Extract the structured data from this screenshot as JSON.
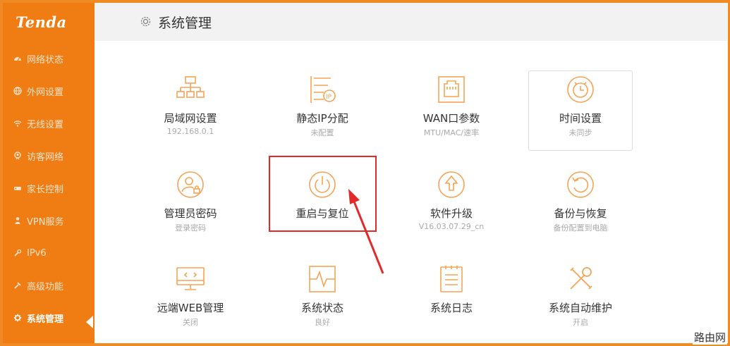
{
  "brand": {
    "logo": "Tenda",
    "accent": "#f07d14"
  },
  "sidebar": {
    "items": [
      {
        "label": "网络状态",
        "icon": "gauge-icon"
      },
      {
        "label": "外网设置",
        "icon": "globe-icon"
      },
      {
        "label": "无线设置",
        "icon": "wifi-icon"
      },
      {
        "label": "访客网络",
        "icon": "guest-icon"
      },
      {
        "label": "家长控制",
        "icon": "parental-icon"
      },
      {
        "label": "VPN服务",
        "icon": "vpn-icon"
      },
      {
        "label": "IPv6",
        "icon": "wrench-icon"
      },
      {
        "label": "高级功能",
        "icon": "tools-icon"
      },
      {
        "label": "系统管理",
        "icon": "gear-icon",
        "active": true
      }
    ]
  },
  "header": {
    "title": "系统管理",
    "icon": "gear-icon"
  },
  "tiles": [
    {
      "label": "局域网设置",
      "sub": "192.168.0.1",
      "icon": "lan-icon"
    },
    {
      "label": "静态IP分配",
      "sub": "未配置",
      "icon": "static-ip-icon"
    },
    {
      "label": "WAN口参数",
      "sub": "MTU/MAC/速率",
      "icon": "wan-port-icon"
    },
    {
      "label": "时间设置",
      "sub": "未同步",
      "icon": "alarm-clock-icon"
    },
    {
      "label": "管理员密码",
      "sub": "登录密码",
      "icon": "admin-lock-icon"
    },
    {
      "label": "重启与复位",
      "sub": "",
      "icon": "power-icon"
    },
    {
      "label": "软件升级",
      "sub": "V16.03.07.29_cn",
      "icon": "upgrade-icon"
    },
    {
      "label": "备份与恢复",
      "sub": "备份配置到电脑",
      "icon": "restore-icon"
    },
    {
      "label": "远端WEB管理",
      "sub": "关闭",
      "icon": "remote-monitor-icon"
    },
    {
      "label": "系统状态",
      "sub": "良好",
      "icon": "pulse-monitor-icon"
    },
    {
      "label": "系统日志",
      "sub": "",
      "icon": "log-list-icon"
    },
    {
      "label": "系统自动维护",
      "sub": "开启",
      "icon": "maintenance-tools-icon"
    }
  ],
  "watermark": "路由网"
}
